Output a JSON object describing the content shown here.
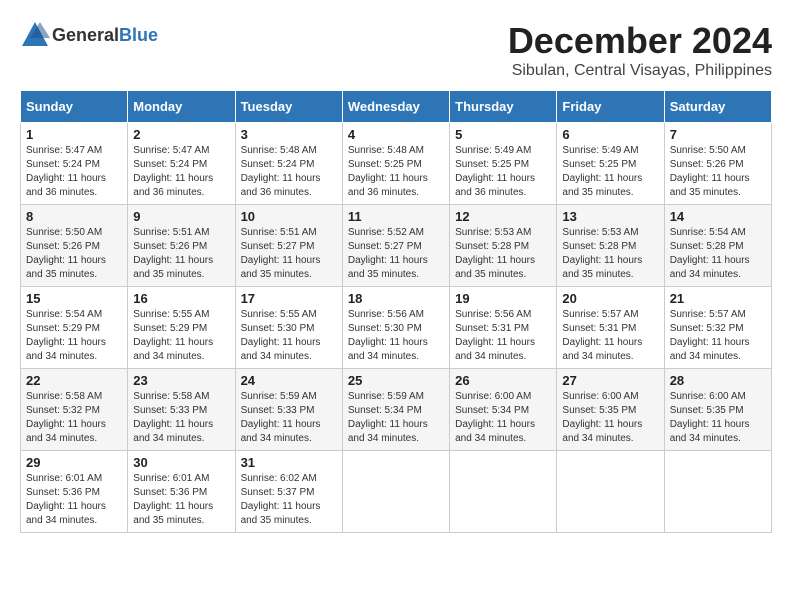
{
  "header": {
    "logo_general": "General",
    "logo_blue": "Blue",
    "title": "December 2024",
    "subtitle": "Sibulan, Central Visayas, Philippines"
  },
  "weekdays": [
    "Sunday",
    "Monday",
    "Tuesday",
    "Wednesday",
    "Thursday",
    "Friday",
    "Saturday"
  ],
  "weeks": [
    [
      {
        "day": "1",
        "info": "Sunrise: 5:47 AM\nSunset: 5:24 PM\nDaylight: 11 hours\nand 36 minutes."
      },
      {
        "day": "2",
        "info": "Sunrise: 5:47 AM\nSunset: 5:24 PM\nDaylight: 11 hours\nand 36 minutes."
      },
      {
        "day": "3",
        "info": "Sunrise: 5:48 AM\nSunset: 5:24 PM\nDaylight: 11 hours\nand 36 minutes."
      },
      {
        "day": "4",
        "info": "Sunrise: 5:48 AM\nSunset: 5:25 PM\nDaylight: 11 hours\nand 36 minutes."
      },
      {
        "day": "5",
        "info": "Sunrise: 5:49 AM\nSunset: 5:25 PM\nDaylight: 11 hours\nand 36 minutes."
      },
      {
        "day": "6",
        "info": "Sunrise: 5:49 AM\nSunset: 5:25 PM\nDaylight: 11 hours\nand 35 minutes."
      },
      {
        "day": "7",
        "info": "Sunrise: 5:50 AM\nSunset: 5:26 PM\nDaylight: 11 hours\nand 35 minutes."
      }
    ],
    [
      {
        "day": "8",
        "info": "Sunrise: 5:50 AM\nSunset: 5:26 PM\nDaylight: 11 hours\nand 35 minutes."
      },
      {
        "day": "9",
        "info": "Sunrise: 5:51 AM\nSunset: 5:26 PM\nDaylight: 11 hours\nand 35 minutes."
      },
      {
        "day": "10",
        "info": "Sunrise: 5:51 AM\nSunset: 5:27 PM\nDaylight: 11 hours\nand 35 minutes."
      },
      {
        "day": "11",
        "info": "Sunrise: 5:52 AM\nSunset: 5:27 PM\nDaylight: 11 hours\nand 35 minutes."
      },
      {
        "day": "12",
        "info": "Sunrise: 5:53 AM\nSunset: 5:28 PM\nDaylight: 11 hours\nand 35 minutes."
      },
      {
        "day": "13",
        "info": "Sunrise: 5:53 AM\nSunset: 5:28 PM\nDaylight: 11 hours\nand 35 minutes."
      },
      {
        "day": "14",
        "info": "Sunrise: 5:54 AM\nSunset: 5:28 PM\nDaylight: 11 hours\nand 34 minutes."
      }
    ],
    [
      {
        "day": "15",
        "info": "Sunrise: 5:54 AM\nSunset: 5:29 PM\nDaylight: 11 hours\nand 34 minutes."
      },
      {
        "day": "16",
        "info": "Sunrise: 5:55 AM\nSunset: 5:29 PM\nDaylight: 11 hours\nand 34 minutes."
      },
      {
        "day": "17",
        "info": "Sunrise: 5:55 AM\nSunset: 5:30 PM\nDaylight: 11 hours\nand 34 minutes."
      },
      {
        "day": "18",
        "info": "Sunrise: 5:56 AM\nSunset: 5:30 PM\nDaylight: 11 hours\nand 34 minutes."
      },
      {
        "day": "19",
        "info": "Sunrise: 5:56 AM\nSunset: 5:31 PM\nDaylight: 11 hours\nand 34 minutes."
      },
      {
        "day": "20",
        "info": "Sunrise: 5:57 AM\nSunset: 5:31 PM\nDaylight: 11 hours\nand 34 minutes."
      },
      {
        "day": "21",
        "info": "Sunrise: 5:57 AM\nSunset: 5:32 PM\nDaylight: 11 hours\nand 34 minutes."
      }
    ],
    [
      {
        "day": "22",
        "info": "Sunrise: 5:58 AM\nSunset: 5:32 PM\nDaylight: 11 hours\nand 34 minutes."
      },
      {
        "day": "23",
        "info": "Sunrise: 5:58 AM\nSunset: 5:33 PM\nDaylight: 11 hours\nand 34 minutes."
      },
      {
        "day": "24",
        "info": "Sunrise: 5:59 AM\nSunset: 5:33 PM\nDaylight: 11 hours\nand 34 minutes."
      },
      {
        "day": "25",
        "info": "Sunrise: 5:59 AM\nSunset: 5:34 PM\nDaylight: 11 hours\nand 34 minutes."
      },
      {
        "day": "26",
        "info": "Sunrise: 6:00 AM\nSunset: 5:34 PM\nDaylight: 11 hours\nand 34 minutes."
      },
      {
        "day": "27",
        "info": "Sunrise: 6:00 AM\nSunset: 5:35 PM\nDaylight: 11 hours\nand 34 minutes."
      },
      {
        "day": "28",
        "info": "Sunrise: 6:00 AM\nSunset: 5:35 PM\nDaylight: 11 hours\nand 34 minutes."
      }
    ],
    [
      {
        "day": "29",
        "info": "Sunrise: 6:01 AM\nSunset: 5:36 PM\nDaylight: 11 hours\nand 34 minutes."
      },
      {
        "day": "30",
        "info": "Sunrise: 6:01 AM\nSunset: 5:36 PM\nDaylight: 11 hours\nand 35 minutes."
      },
      {
        "day": "31",
        "info": "Sunrise: 6:02 AM\nSunset: 5:37 PM\nDaylight: 11 hours\nand 35 minutes."
      },
      {
        "day": "",
        "info": ""
      },
      {
        "day": "",
        "info": ""
      },
      {
        "day": "",
        "info": ""
      },
      {
        "day": "",
        "info": ""
      }
    ]
  ]
}
